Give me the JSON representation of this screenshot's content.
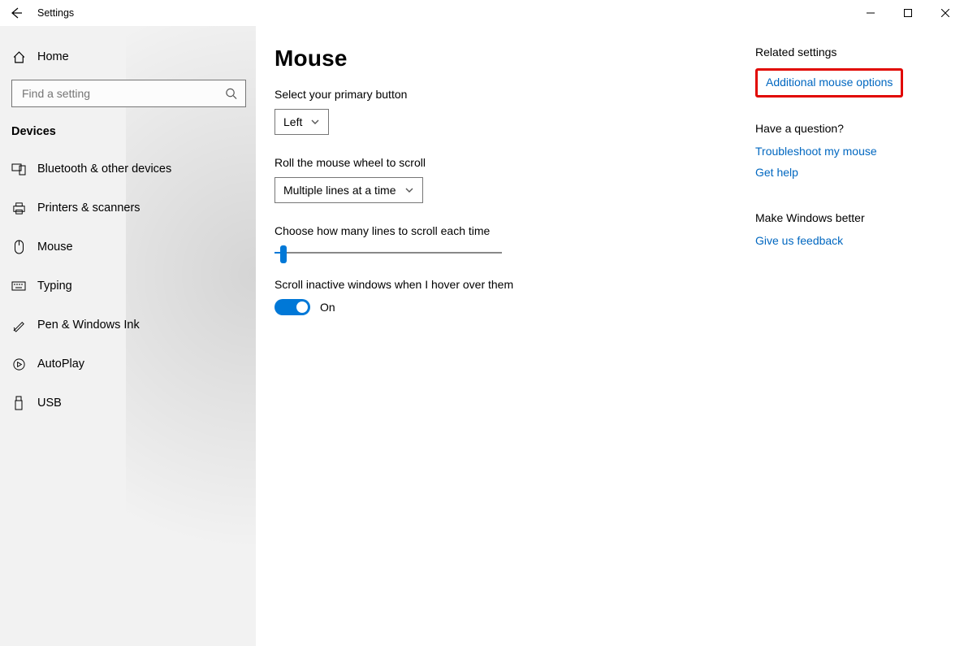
{
  "titlebar": {
    "title": "Settings"
  },
  "sidebar": {
    "home_label": "Home",
    "search_placeholder": "Find a setting",
    "category": "Devices",
    "items": [
      {
        "label": "Bluetooth & other devices"
      },
      {
        "label": "Printers & scanners"
      },
      {
        "label": "Mouse"
      },
      {
        "label": "Typing"
      },
      {
        "label": "Pen & Windows Ink"
      },
      {
        "label": "AutoPlay"
      },
      {
        "label": "USB"
      }
    ]
  },
  "main": {
    "page_title": "Mouse",
    "primary_button_label": "Select your primary button",
    "primary_button_value": "Left",
    "wheel_label": "Roll the mouse wheel to scroll",
    "wheel_value": "Multiple lines at a time",
    "lines_label": "Choose how many lines to scroll each time",
    "slider_percent": 4,
    "hover_label": "Scroll inactive windows when I hover over them",
    "toggle_state": "On"
  },
  "related": {
    "heading": "Related settings",
    "additional": "Additional mouse options",
    "question_heading": "Have a question?",
    "troubleshoot": "Troubleshoot my mouse",
    "get_help": "Get help",
    "better_heading": "Make Windows better",
    "feedback": "Give us feedback"
  }
}
